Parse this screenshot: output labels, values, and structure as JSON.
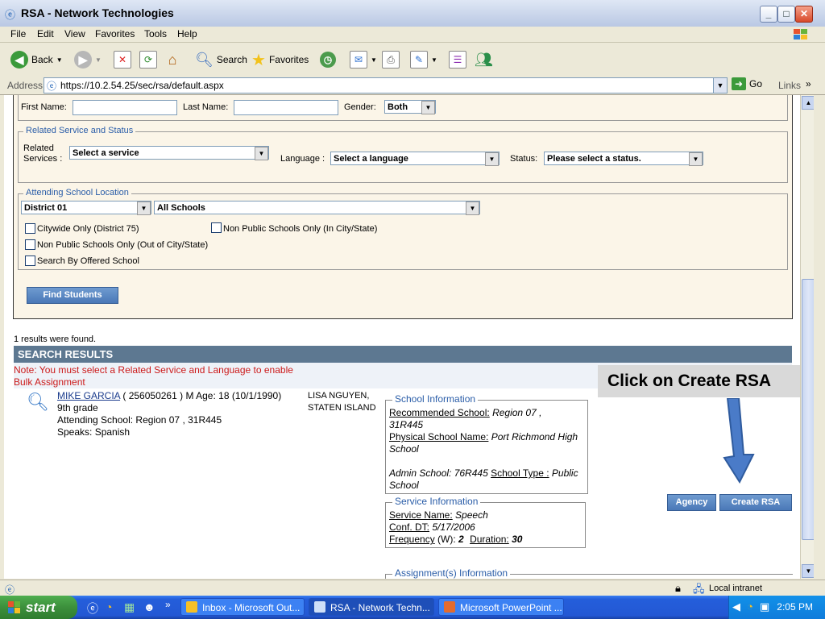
{
  "window": {
    "title": "RSA - Network Technologies"
  },
  "menu": [
    "File",
    "Edit",
    "View",
    "Favorites",
    "Tools",
    "Help"
  ],
  "toolbar": {
    "back": "Back",
    "search": "Search",
    "favorites": "Favorites"
  },
  "address": {
    "label": "Address",
    "url": "https://10.2.54.25/sec/rsa/default.aspx",
    "go": "Go",
    "links": "Links"
  },
  "form": {
    "first_name_label": "First Name:",
    "last_name_label": "Last Name:",
    "gender_label": "Gender:",
    "gender_value": "Both",
    "related_legend": "Related Service and Status",
    "related_services_label_1": "Related",
    "related_services_label_2": "Services :",
    "service_value": "Select a service",
    "language_label": "Language :",
    "language_value": "Select a language",
    "status_label": "Status:",
    "status_value": "Please select a status.",
    "location_legend": "Attending School Location",
    "district_value": "District 01",
    "schools_value": "All Schools",
    "chk_citywide": "Citywide Only (District 75)",
    "chk_nonpublic_in": "Non Public Schools Only (In City/State)",
    "chk_nonpublic_out": "Non Public Schools Only (Out of City/State)",
    "chk_offered": "Search By Offered School",
    "find_button": "Find Students"
  },
  "results": {
    "count_text": "1 results were found.",
    "header": "SEARCH RESULTS",
    "note": "Note: You must select a Related Service and Language to enable Bulk Assignment",
    "student": {
      "name": "MIKE GARCIA",
      "id": "( 256050261 )",
      "age": "M Age: 18 (10/1/1990)",
      "grade": "9th grade",
      "attending": "Attending School: Region 07 , 31R445",
      "speaks": "Speaks: Spanish",
      "provider_line1": "LISA  NGUYEN,",
      "provider_line2": "STATEN ISLAND"
    },
    "school_info": {
      "legend": "School Information",
      "recommended_label": "Recommended School:",
      "recommended_value": " Region 07 ,",
      "recommended_value2": "31R445",
      "physical_label": "Physical School Name:",
      "physical_value": " Port Richmond High",
      "physical_value2": "School",
      "admin": "Admin School: 76R445 ",
      "type_label": "School Type :",
      "type_value": " Public",
      "type_value2": "School"
    },
    "service_info": {
      "legend": "Service Information",
      "service_label": "Service Name:",
      "service_value": " Speech",
      "conf_label": "Conf. DT:",
      "conf_value": " 5/17/2006",
      "freq_label": "Frequency",
      "freq_unit": " (W): ",
      "freq_value": "2",
      "dur_label": "Duration:",
      "dur_value": " 30"
    },
    "assignment_legend": "Assignment(s) Information",
    "agency_button": "Agency",
    "create_button": "Create RSA"
  },
  "callout": "Click on Create RSA",
  "statusbar": {
    "zone": "Local intranet"
  },
  "taskbar": {
    "start": "start",
    "tasks": [
      "Inbox - Microsoft Out...",
      "RSA - Network Techn...",
      "Microsoft PowerPoint ..."
    ],
    "clock": "2:05 PM"
  }
}
